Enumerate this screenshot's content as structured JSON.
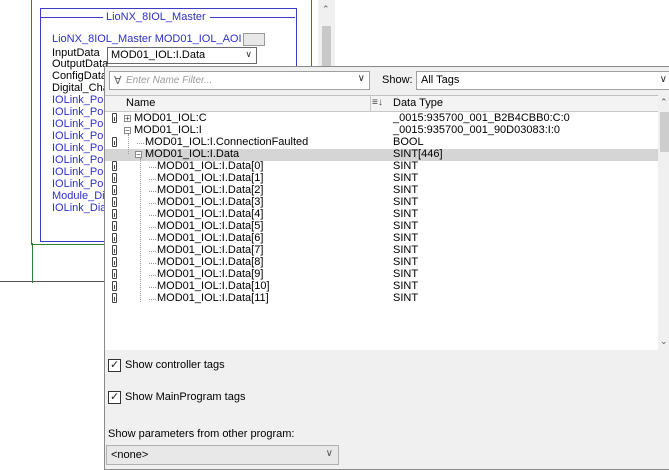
{
  "aoi": {
    "title": "LioNX_8IOL_Master",
    "instance_row": "LioNX_8IOL_Master  MOD01_IOL_AOI",
    "input_data_label": "InputData",
    "input_data_value": "MOD01_IOL:I.Data",
    "params": [
      "OutputData",
      "ConfigData",
      "Digital_Cha",
      "IOLink_Por",
      "IOLink_Por",
      "IOLink_Por",
      "IOLink_Por",
      "IOLink_Por",
      "IOLink_Por",
      "IOLink_Por",
      "IOLink_Por",
      "Module_Dia",
      "IOLink_Dia"
    ]
  },
  "filter": {
    "placeholder": "Enter Name Filter..."
  },
  "show": {
    "label": "Show:",
    "value": "All Tags"
  },
  "grid": {
    "header_name": "Name",
    "header_type": "Data Type",
    "rows": [
      {
        "name": "MOD01_IOL:C",
        "type": "_0015:935700_001_B2B4CBB0:C:0"
      },
      {
        "name": "MOD01_IOL:I",
        "type": "_0015:935700_001_90D03083:I:0"
      },
      {
        "name": "MOD01_IOL:I.ConnectionFaulted",
        "type": "BOOL"
      },
      {
        "name": "MOD01_IOL:I.Data",
        "type": "SINT[446]"
      },
      {
        "name": "MOD01_IOL:I.Data[0]",
        "type": "SINT"
      },
      {
        "name": "MOD01_IOL:I.Data[1]",
        "type": "SINT"
      },
      {
        "name": "MOD01_IOL:I.Data[2]",
        "type": "SINT"
      },
      {
        "name": "MOD01_IOL:I.Data[3]",
        "type": "SINT"
      },
      {
        "name": "MOD01_IOL:I.Data[4]",
        "type": "SINT"
      },
      {
        "name": "MOD01_IOL:I.Data[5]",
        "type": "SINT"
      },
      {
        "name": "MOD01_IOL:I.Data[6]",
        "type": "SINT"
      },
      {
        "name": "MOD01_IOL:I.Data[7]",
        "type": "SINT"
      },
      {
        "name": "MOD01_IOL:I.Data[8]",
        "type": "SINT"
      },
      {
        "name": "MOD01_IOL:I.Data[9]",
        "type": "SINT"
      },
      {
        "name": "MOD01_IOL:I.Data[10]",
        "type": "SINT"
      },
      {
        "name": "MOD01_IOL:I.Data[11]",
        "type": "SINT"
      }
    ]
  },
  "options": {
    "show_controller_tags": "Show controller tags",
    "show_mainprogram_tags": "Show MainProgram tags",
    "show_params_label": "Show parameters from other program:",
    "program_value": "<none>"
  },
  "colors": {
    "param_text": "#2f2fc9",
    "selected_row": "#d5d5d5",
    "aoi_outer_border": "#2e7d32"
  }
}
